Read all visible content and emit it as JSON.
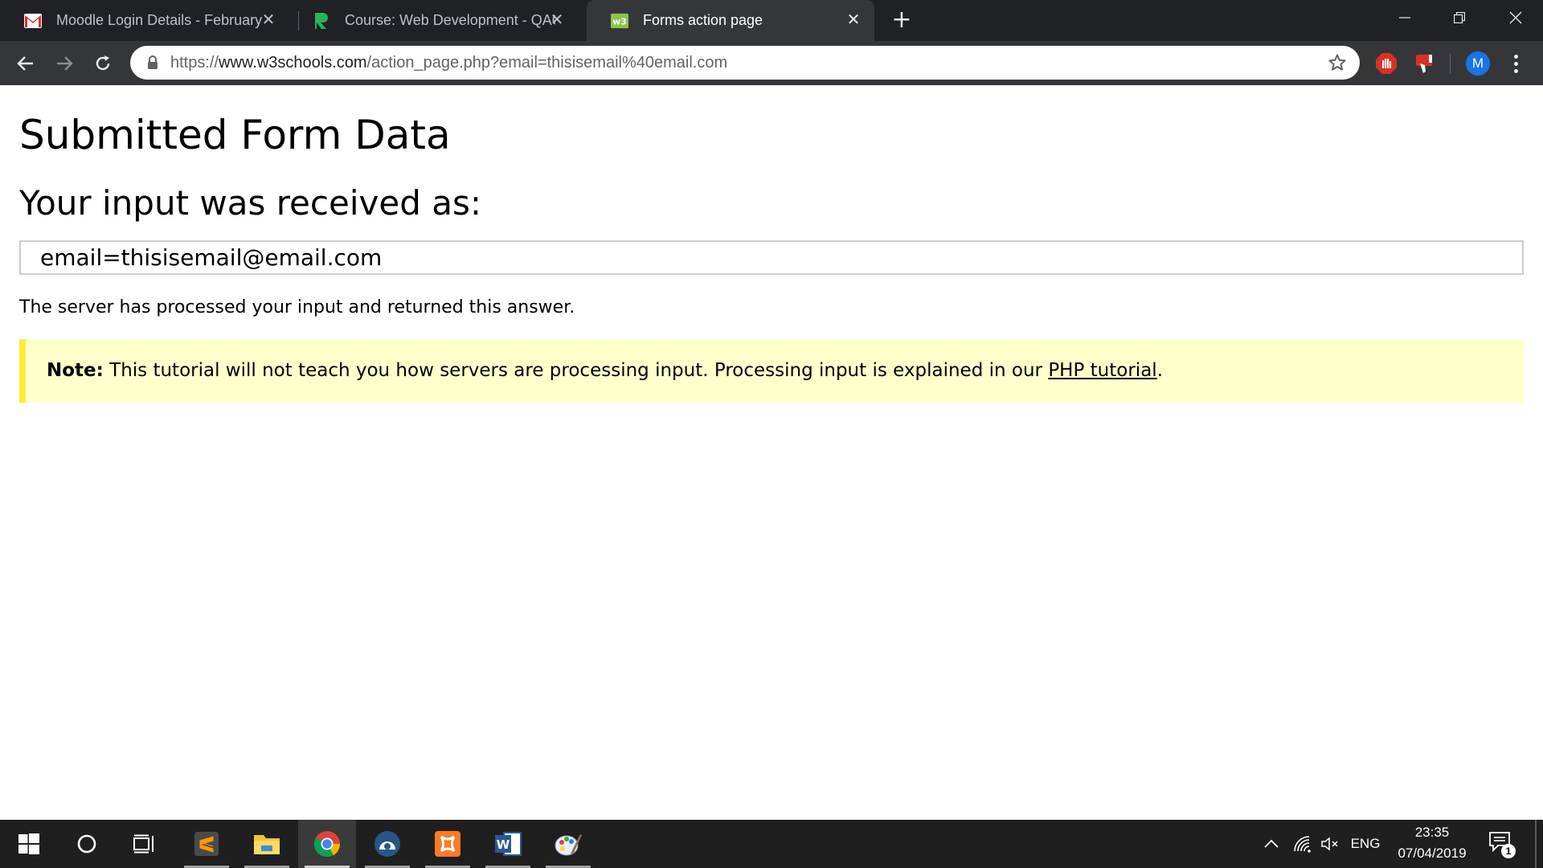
{
  "browser": {
    "tabs": [
      {
        "label": "Moodle Login Details - February",
        "icon": "gmail-icon",
        "active": false
      },
      {
        "label": "Course: Web Development - QAC",
        "icon": "course-icon",
        "active": false
      },
      {
        "label": "Forms action page",
        "icon": "w3schools-icon",
        "active": true
      }
    ],
    "new_tab_icon": "plus-icon",
    "url_scheme": "https://",
    "url_host": "www.w3schools.com",
    "url_path": "/action_page.php?email=thisisemail%40email.com",
    "profile_initial": "M",
    "colors": {
      "tabbar": "#202124",
      "toolbar": "#35363a",
      "profile": "#1a73e8",
      "ext_red": "#d93025"
    }
  },
  "page": {
    "title": "Submitted Form Data",
    "subtitle": "Your input was received as:",
    "result": "email=thisisemail@email.com",
    "message": "The server has processed your input and returned this answer.",
    "note": {
      "label": "Note:",
      "text": " This tutorial will not teach you how servers are processing input. Processing input is explained in our ",
      "link": "PHP tutorial",
      "end": "."
    },
    "colors": {
      "note_bg": "#ffffcc",
      "note_border": "#ffeb3b",
      "result_border": "#cccccc"
    }
  },
  "taskbar": {
    "apps": [
      {
        "name": "sublime-text-icon",
        "running": true,
        "active": false
      },
      {
        "name": "file-explorer-icon",
        "running": true,
        "active": false
      },
      {
        "name": "chrome-icon",
        "running": true,
        "active": true
      },
      {
        "name": "blender-icon",
        "running": true,
        "active": false
      },
      {
        "name": "xampp-icon",
        "running": true,
        "active": false
      },
      {
        "name": "word-icon",
        "running": true,
        "active": false
      },
      {
        "name": "paint-icon",
        "running": true,
        "active": false
      }
    ],
    "language": "ENG",
    "time": "23:35",
    "date": "07/04/2019",
    "notification_count": "1"
  }
}
